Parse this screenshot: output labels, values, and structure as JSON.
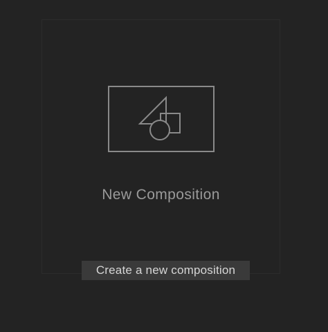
{
  "card": {
    "label": "New Composition",
    "icon": "composition-shapes-icon"
  },
  "tooltip": {
    "text": "Create a new composition"
  },
  "colors": {
    "background": "#232323",
    "icon_stroke": "#8a8a8a",
    "label_text": "#9a9a9a",
    "tooltip_bg": "#3a3a3a",
    "tooltip_text": "#d6d6d6"
  }
}
